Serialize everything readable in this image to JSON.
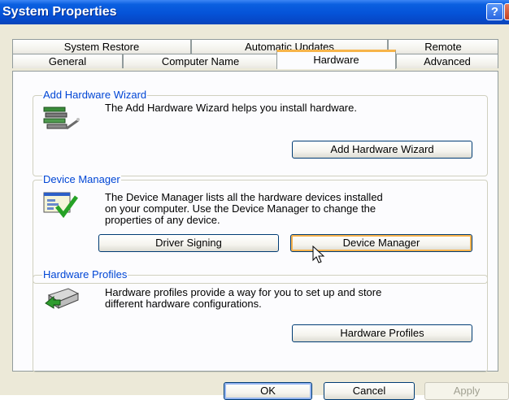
{
  "window": {
    "title": "System Properties",
    "help_button": "?",
    "close_button": "✕"
  },
  "tabs": {
    "row_back": [
      "System Restore",
      "Automatic Updates",
      "Remote"
    ],
    "row_front": [
      "General",
      "Computer Name",
      "Hardware",
      "Advanced"
    ],
    "selected": "Hardware"
  },
  "add_hardware": {
    "group_label": "Add Hardware Wizard",
    "description": "The Add Hardware Wizard helps you install hardware.",
    "button_label": "Add Hardware Wizard",
    "icon": "add-hardware-wizard-icon"
  },
  "device_manager": {
    "group_label": "Device Manager",
    "description_lines": [
      "The Device Manager lists all the hardware devices installed",
      "on your computer. Use the Device Manager to change the",
      "properties of any device."
    ],
    "driver_signing_label": "Driver Signing",
    "button_label": "Device Manager",
    "icon": "device-manager-icon"
  },
  "hardware_profiles": {
    "group_label": "Hardware Profiles",
    "description_lines": [
      "Hardware profiles provide a way for you to set up and store",
      "different hardware configurations."
    ],
    "button_label": "Hardware Profiles",
    "icon": "hardware-profiles-icon"
  },
  "footer": {
    "ok_label": "OK",
    "cancel_label": "Cancel",
    "apply_label": "Apply"
  },
  "colors": {
    "titlebar": "#0553d8",
    "dialog_bg": "#ece9d8",
    "page_bg": "#fcfcfe",
    "group_label": "#0046d5",
    "tab_highlight": "#f7b44a"
  }
}
